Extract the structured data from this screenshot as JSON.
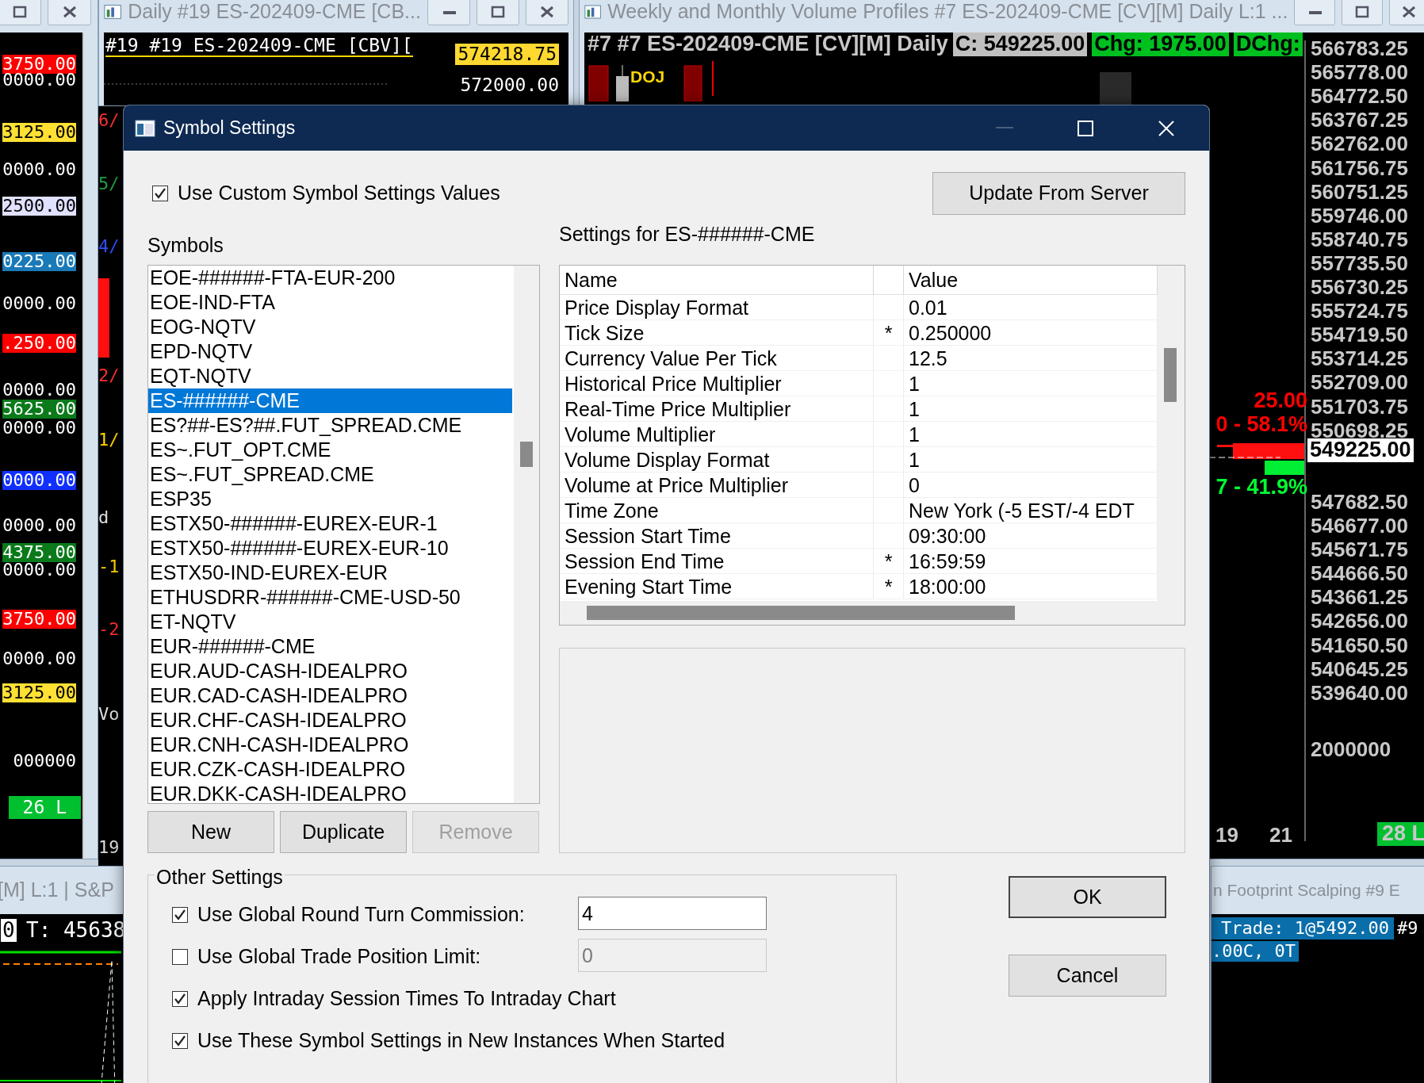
{
  "left_chart": {
    "price_labels": [
      {
        "text": "3750.00",
        "color": "#ff0000"
      },
      {
        "text": "0000.00"
      },
      {
        "text": "3125.00",
        "color": "#ffe033"
      },
      {
        "text": "0000.00"
      },
      {
        "text": "2500.00",
        "color": "#e0e0ff"
      },
      {
        "text": "0225.00",
        "color": "#1a7ab8"
      },
      {
        "text": "0000.00"
      },
      {
        "text": ".250.00",
        "color": "#ff0000"
      },
      {
        "text": "0000.00"
      },
      {
        "text": "5625.00",
        "color": "#0a7a1a"
      },
      {
        "text": "0000.00"
      },
      {
        "text": "0000.00",
        "color": "#1030ff"
      },
      {
        "text": "0000.00"
      },
      {
        "text": "4375.00",
        "color": "#0a7a1a"
      },
      {
        "text": "0000.00"
      },
      {
        "text": "3750.00",
        "color": "#ff0000"
      },
      {
        "text": "0000.00"
      },
      {
        "text": "3125.00",
        "color": "#ffe033"
      },
      {
        "text": "000000"
      }
    ],
    "footer_badge": "26 L"
  },
  "middle_chart": {
    "title": "Daily #19 ES-202409-CME [CB...",
    "header": "#19 #19 ES-202409-CME [CBV][",
    "price_badge": "574218.75",
    "price_label": "572000.00",
    "axis_labels": [
      "6/",
      "5/",
      "4/",
      "2/",
      "1/",
      "d",
      "-1",
      "-2",
      "Vo",
      "19"
    ]
  },
  "right_chart": {
    "title": "Weekly and Monthly Volume Profiles #7 ES-202409-CME [CV][M]  Daily L:1 ...",
    "header": "#7 #7 ES-202409-CME [CV][M]  Daily",
    "badges": [
      {
        "text": "C: 549225.00",
        "color": "#c0c0c0"
      },
      {
        "text": "Chg: 1975.00",
        "color": "#00c020"
      },
      {
        "text": "DChg:",
        "color": "#00c020"
      }
    ],
    "bar_label": "DOJ",
    "axis_labels": [
      "566783.25",
      "565778.00",
      "564772.50",
      "563767.25",
      "562762.00",
      "561756.75",
      "560751.25",
      "559746.00",
      "558740.75",
      "557735.50",
      "556730.25",
      "555724.75",
      "554719.50",
      "553714.25",
      "552709.00",
      "551703.75",
      "550698.25",
      "547682.50",
      "546677.00",
      "545671.75",
      "544666.50",
      "543661.25",
      "542656.00",
      "541650.50",
      "540645.25",
      "539640.00"
    ],
    "last_price": "549225.00",
    "volume_label": "2000000",
    "stats": [
      {
        "text": "25.00",
        "color": "#ff0000"
      },
      {
        "text": "0 - 58.1%",
        "color": "#ff0000"
      },
      {
        "text": "7 - 41.9%",
        "color": "#00ff33"
      }
    ],
    "date_labels": [
      "19",
      "21"
    ],
    "footer_badge": "28 L"
  },
  "bottom_left_chart": {
    "title": "[M] L:1 | S&P",
    "readout_badge": "0",
    "readout": "T: 45638"
  },
  "bottom_right_chart": {
    "title": "n Footprint Scalping #9 E",
    "trade": "Trade: 1@5492.00",
    "tag": "#9",
    "summary": ".00C, 0T"
  },
  "dialog": {
    "title": "Symbol Settings",
    "use_custom": {
      "label": "Use Custom Symbol Settings Values",
      "checked": true
    },
    "update_button": "Update From Server",
    "symbols_label": "Symbols",
    "symbols": [
      {
        "text": "EOE-######-FTA-EUR-200",
        "selected": false
      },
      {
        "text": "EOE-IND-FTA",
        "selected": false
      },
      {
        "text": "EOG-NQTV",
        "selected": false
      },
      {
        "text": "EPD-NQTV",
        "selected": false
      },
      {
        "text": "EQT-NQTV",
        "selected": false
      },
      {
        "text": "ES-######-CME",
        "selected": true
      },
      {
        "text": "ES?##-ES?##.FUT_SPREAD.CME",
        "selected": false
      },
      {
        "text": "ES~.FUT_OPT.CME",
        "selected": false
      },
      {
        "text": "ES~.FUT_SPREAD.CME",
        "selected": false
      },
      {
        "text": "ESP35",
        "selected": false
      },
      {
        "text": "ESTX50-######-EUREX-EUR-1",
        "selected": false
      },
      {
        "text": "ESTX50-######-EUREX-EUR-10",
        "selected": false
      },
      {
        "text": "ESTX50-IND-EUREX-EUR",
        "selected": false
      },
      {
        "text": "ETHUSDRR-######-CME-USD-50",
        "selected": false
      },
      {
        "text": "ET-NQTV",
        "selected": false
      },
      {
        "text": "EUR-######-CME",
        "selected": false
      },
      {
        "text": "EUR.AUD-CASH-IDEALPRO",
        "selected": false
      },
      {
        "text": "EUR.CAD-CASH-IDEALPRO",
        "selected": false
      },
      {
        "text": "EUR.CHF-CASH-IDEALPRO",
        "selected": false
      },
      {
        "text": "EUR.CNH-CASH-IDEALPRO",
        "selected": false
      },
      {
        "text": "EUR.CZK-CASH-IDEALPRO",
        "selected": false
      },
      {
        "text": "EUR.DKK-CASH-IDEALPRO",
        "selected": false
      }
    ],
    "list_buttons": [
      {
        "label": "New",
        "disabled": false
      },
      {
        "label": "Duplicate",
        "disabled": false
      },
      {
        "label": "Remove",
        "disabled": true
      }
    ],
    "settings_label": "Settings for ES-######-CME",
    "columns": [
      "Name",
      "Value"
    ],
    "settings": [
      {
        "name": "Price Display Format",
        "value": "0.01"
      },
      {
        "name": "Tick Size",
        "flag": "*",
        "value": "0.250000"
      },
      {
        "name": "Currency Value Per Tick",
        "value": "12.5"
      },
      {
        "name": "Historical Price Multiplier",
        "value": "1"
      },
      {
        "name": "Real-Time Price Multiplier",
        "value": "1"
      },
      {
        "name": "Volume Multiplier",
        "value": "1"
      },
      {
        "name": "Volume Display Format",
        "value": "1"
      },
      {
        "name": "Volume at Price Multiplier",
        "value": "0"
      },
      {
        "name": "Time Zone",
        "value": "New York (-5 EST/-4 EDT"
      },
      {
        "name": "Session Start Time",
        "value": "09:30:00"
      },
      {
        "name": "Session End Time",
        "flag": "*",
        "value": "16:59:59"
      },
      {
        "name": "Evening Start Time",
        "flag": "*",
        "value": "18:00:00"
      }
    ],
    "other_settings_label": "Other Settings",
    "other_settings": [
      {
        "kind": "field",
        "label": "Use Global Round Turn Commission:",
        "checked": true,
        "value": "4",
        "disabled": false
      },
      {
        "kind": "field",
        "label": "Use Global Trade Position Limit:",
        "checked": false,
        "value": "0",
        "disabled": true
      },
      {
        "kind": "check",
        "label": "Apply Intraday Session Times To Intraday Chart",
        "checked": true
      },
      {
        "kind": "check",
        "label": "Use These Symbol Settings in New Instances When Started",
        "checked": true
      }
    ],
    "ok_button": "OK",
    "cancel_button": "Cancel"
  }
}
